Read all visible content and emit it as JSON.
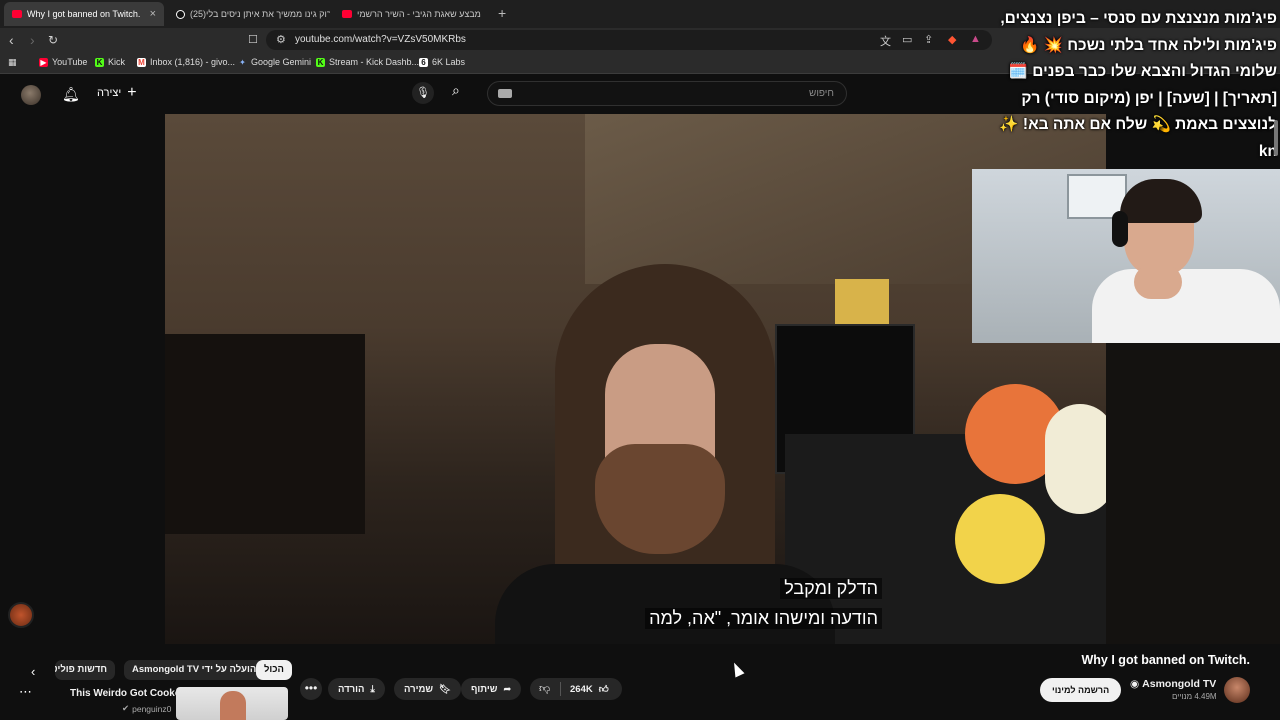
{
  "browser": {
    "tabs": [
      {
        "title": "Why I got banned on Twitch.",
        "active": true
      },
      {
        "title": "(25)רוק גינו ממשיך את איתן ניסים בלי",
        "active": false
      },
      {
        "title": "מבצע שאגת הגיבי - השיר הרשמי ",
        "active": false
      }
    ],
    "tab_close": "×",
    "new_tab": "+",
    "url": "youtube.com/watch?v=VZsV50MKRbs",
    "bookmarks": [
      {
        "label": "YouTube",
        "color": "#ff0033",
        "glyph": "▶"
      },
      {
        "label": "Kick",
        "color": "#53fc18",
        "glyph": "K"
      },
      {
        "label": "Inbox (1,816) - givo...",
        "color": "#ea4335",
        "glyph": "M"
      },
      {
        "label": "Google Gemini",
        "color": "#8ab4f8",
        "glyph": "✦"
      },
      {
        "label": "Stream - Kick Dashb...",
        "color": "#53fc18",
        "glyph": "K"
      },
      {
        "label": "6K Labs",
        "color": "#ffffff",
        "glyph": "6"
      }
    ]
  },
  "header": {
    "create_label": "יצירה",
    "search_placeholder": "חיפוש"
  },
  "video": {
    "captions": [
      "הדלק ומקבל",
      "הודעה ומישהו אומר, \"אה, למה"
    ]
  },
  "overlay": {
    "text": "פיג'מות מנצנצת עם סנסי – ביפן נצנצים, פיג'מות ולילה אחד בלתי נשכח 💥 🔥 שלומי הגדול והצבא שלו כבר בפנים 🗓️ [תאריך] | [שעה] | יפן (מיקום סודי) רק לנוצצים באמת 💫 שלח אם אתה בא! ✨ kn"
  },
  "chips": {
    "all": "הכול",
    "uploaded_by": "הועלה על ידי Asmongold TV",
    "news": "חדשות פוליטיקה"
  },
  "recommendation": {
    "title": "This Weirdo Got Cooked",
    "channel": "penguinz0"
  },
  "actions": {
    "download": "הורדה",
    "save": "שמירה",
    "share": "שיתוף",
    "likes": "264K"
  },
  "video_info": {
    "title": "Why I got banned on Twitch.",
    "channel": "Asmongold TV",
    "subscribers": "4.49M מנויים",
    "subscribe_label": "הרשמה למינוי"
  },
  "colors": {
    "background": "#0f0f0f",
    "chip": "#272727",
    "chip_selected": "#f1f1f1",
    "youtube_red": "#ff0033"
  }
}
